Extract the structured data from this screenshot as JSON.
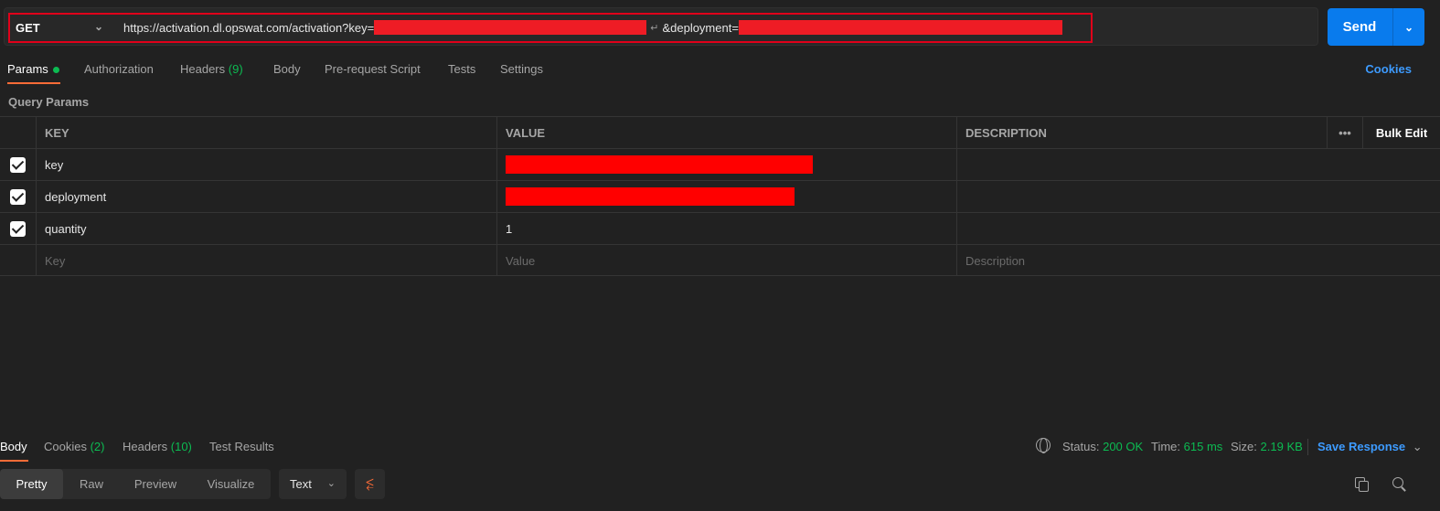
{
  "request": {
    "method": "GET",
    "url_base": "https://activation.dl.opswat.com/activation?key=",
    "url_deployment": "&deployment=",
    "wrap_glyph": "↵",
    "send_label": "Send"
  },
  "request_tabs": {
    "params": "Params",
    "authorization": "Authorization",
    "headers": "Headers",
    "headers_count": "(9)",
    "body": "Body",
    "prerequest": "Pre-request Script",
    "tests": "Tests",
    "settings": "Settings",
    "cookies": "Cookies"
  },
  "query_params": {
    "title": "Query Params",
    "headers": {
      "key": "KEY",
      "value": "VALUE",
      "description": "DESCRIPTION",
      "more": "•••",
      "bulk_edit": "Bulk Edit"
    },
    "rows": [
      {
        "key": "key",
        "value": "",
        "redacted": true
      },
      {
        "key": "deployment",
        "value": "",
        "redacted": true
      },
      {
        "key": "quantity",
        "value": "1",
        "redacted": false
      }
    ],
    "placeholder": {
      "key": "Key",
      "value": "Value",
      "description": "Description"
    }
  },
  "response_tabs": {
    "body": "Body",
    "cookies": "Cookies",
    "cookies_count": "(2)",
    "headers": "Headers",
    "headers_count": "(10)",
    "test_results": "Test Results"
  },
  "response_status": {
    "status_label": "Status:",
    "status_value": "200 OK",
    "time_label": "Time:",
    "time_value": "615 ms",
    "size_label": "Size:",
    "size_value": "2.19 KB",
    "save_response": "Save Response"
  },
  "view_modes": {
    "pretty": "Pretty",
    "raw": "Raw",
    "preview": "Preview",
    "visualize": "Visualize",
    "format": "Text"
  },
  "colors": {
    "accent_orange": "#ff6c37",
    "send_blue": "#097bed",
    "success_green": "#0cbb52",
    "redaction_red": "#ee1c25"
  }
}
